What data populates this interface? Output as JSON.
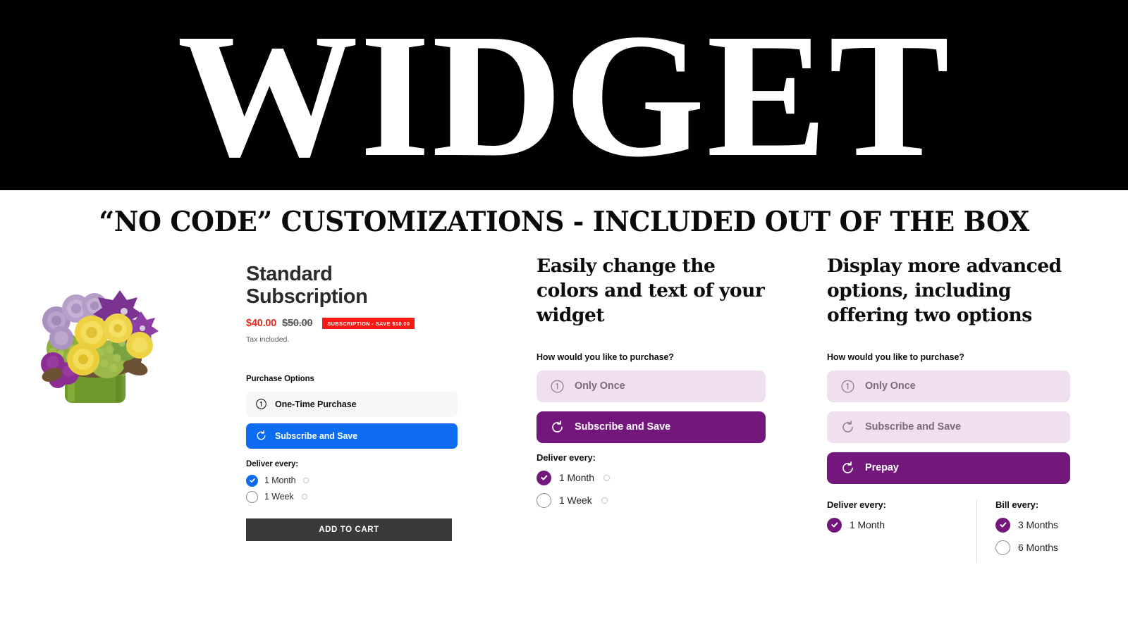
{
  "hero": {
    "title": "WIDGET",
    "subtitle": "“NO CODE” CUSTOMIZATIONS - INCLUDED OUT OF THE BOX"
  },
  "product": {
    "image_alt": "flower-bouquet",
    "title": "Standard Subscription",
    "sale_price": "$40.00",
    "compare_price": "$50.00",
    "save_badge": "SUBSCRIPTION - SAVE $10.00",
    "tax_note": "Tax included.",
    "purchase_options_label": "Purchase Options",
    "options": [
      {
        "label": "One-Time Purchase",
        "icon": "one-circle-icon",
        "selected": false
      },
      {
        "label": "Subscribe and Save",
        "icon": "refresh-cycle-icon",
        "selected": true
      }
    ],
    "frequency_label": "Deliver every:",
    "frequencies": [
      {
        "label": "1 Month",
        "selected": true
      },
      {
        "label": "1 Week",
        "selected": false
      }
    ],
    "add_to_cart_label": "ADD TO CART"
  },
  "demo_colors": {
    "heading": "Easily change the colors and text of your widget",
    "question_label": "How would you like to purchase?",
    "options": [
      {
        "label": "Only Once",
        "icon": "one-circle-icon",
        "selected": false
      },
      {
        "label": "Subscribe and Save",
        "icon": "refresh-cycle-icon",
        "selected": true
      }
    ],
    "frequency_label": "Deliver every:",
    "frequencies": [
      {
        "label": "1 Month",
        "selected": true
      },
      {
        "label": "1 Week",
        "selected": false
      }
    ]
  },
  "demo_advanced": {
    "heading": "Display more advanced options, including offering two options",
    "question_label": "How would you like to purchase?",
    "options": [
      {
        "label": "Only Once",
        "icon": "one-circle-icon",
        "selected": false
      },
      {
        "label": "Subscribe and Save",
        "icon": "refresh-cycle-icon",
        "selected": false
      },
      {
        "label": "Prepay",
        "icon": "refresh-cycle-icon",
        "selected": true
      }
    ],
    "deliver_label": "Deliver every:",
    "deliver_options": [
      {
        "label": "1 Month",
        "selected": true
      }
    ],
    "bill_label": "Bill every:",
    "bill_options": [
      {
        "label": "3 Months",
        "selected": true
      },
      {
        "label": "6 Months",
        "selected": false
      }
    ]
  },
  "theme": {
    "black": "#000000",
    "blue_accent": "#0d6cef",
    "purple_accent": "#73177d",
    "purple_tint": "#efdfef",
    "red_sale": "#e12b20",
    "red_badge": "#f51b14",
    "dark_button": "#3a3a3a"
  }
}
